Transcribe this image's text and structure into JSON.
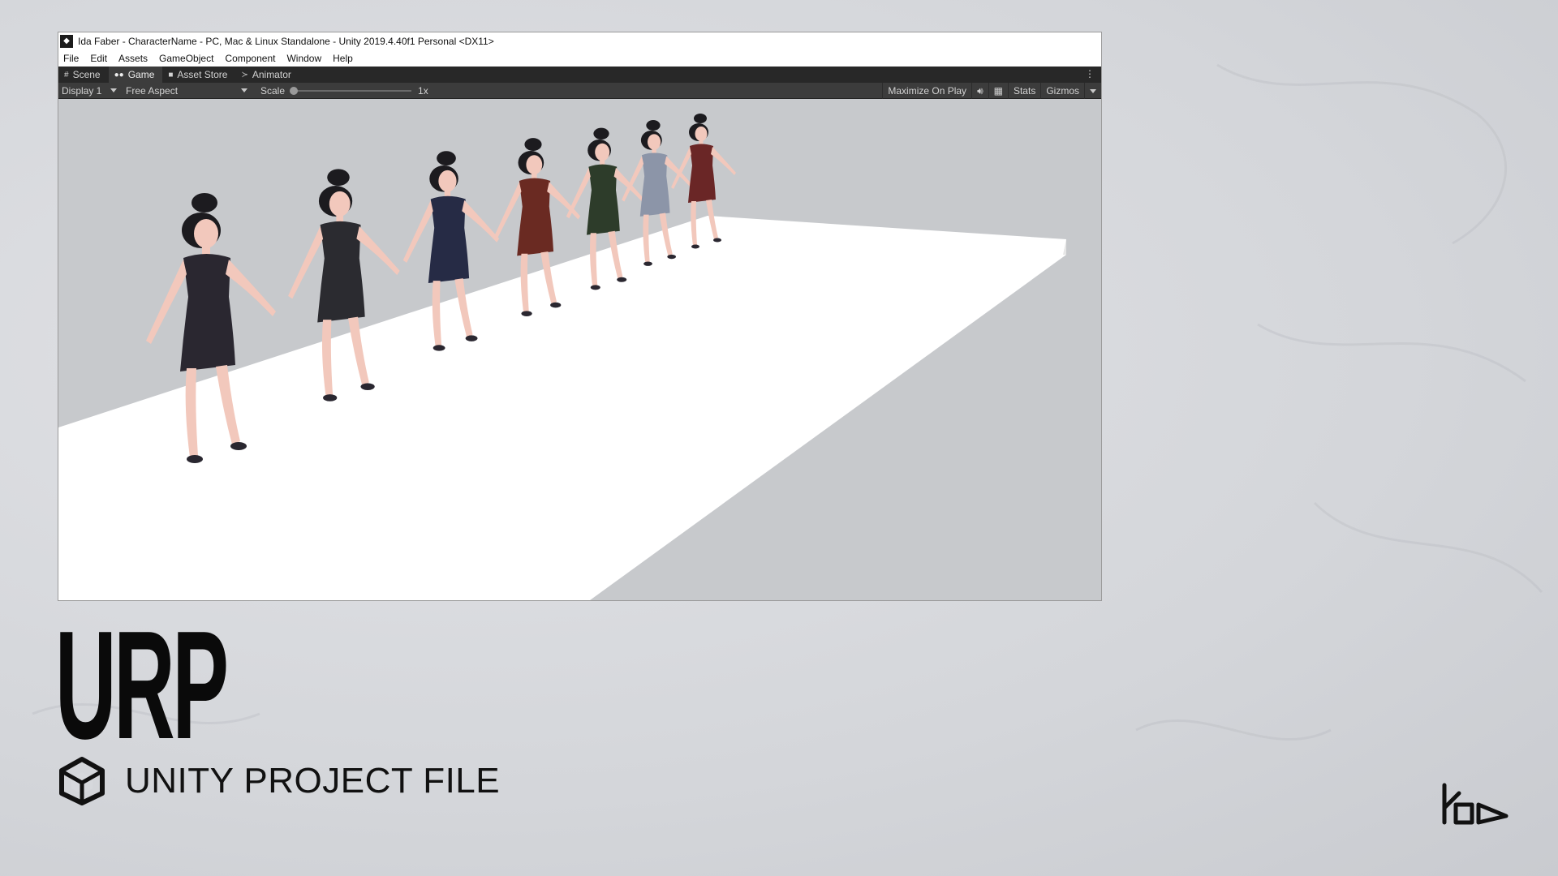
{
  "window": {
    "title": "Ida Faber - CharacterName - PC, Mac & Linux Standalone - Unity 2019.4.40f1 Personal <DX11>"
  },
  "menubar": {
    "items": [
      "File",
      "Edit",
      "Assets",
      "GameObject",
      "Component",
      "Window",
      "Help"
    ]
  },
  "tabs": [
    {
      "label": "Scene",
      "icon": "grid-icon"
    },
    {
      "label": "Game",
      "icon": "gamepad-icon",
      "active": true
    },
    {
      "label": "Asset Store",
      "icon": "bag-icon"
    },
    {
      "label": "Animator",
      "icon": "animator-icon"
    }
  ],
  "toolbar": {
    "display": "Display 1",
    "aspect": "Free Aspect",
    "scale_label": "Scale",
    "scale_value": "1x",
    "scale_slider": 0,
    "maximize": "Maximize On Play",
    "stats": "Stats",
    "gizmos": "Gizmos"
  },
  "viewport": {
    "characters": [
      {
        "dress_color": "#2a2730"
      },
      {
        "dress_color": "#2b2b30"
      },
      {
        "dress_color": "#262b45"
      },
      {
        "dress_color": "#6a2a22"
      },
      {
        "dress_color": "#2d3c2a"
      },
      {
        "dress_color": "#8c95a8"
      },
      {
        "dress_color": "#6a2626"
      }
    ]
  },
  "branding": {
    "title": "URP",
    "subtitle": "UNITY PROJECT FILE"
  },
  "colors": {
    "accent": "#0a0a0a",
    "background": "#d6d8dc"
  }
}
